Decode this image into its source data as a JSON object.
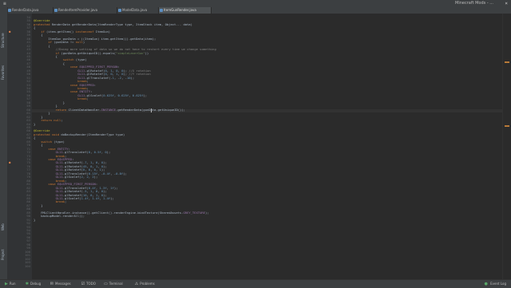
{
  "window": {
    "title": "Minecraft Mods - ..."
  },
  "tabs": [
    {
      "label": "RenderData.java",
      "active": false
    },
    {
      "label": "RenderItemProvider.java",
      "active": false
    },
    {
      "label": "ModelData.java",
      "active": false
    },
    {
      "label": "ItemGunRender.java",
      "active": true
    }
  ],
  "left_tools": [
    "Structure",
    "Favorites",
    "Web",
    "Project"
  ],
  "line_numbers": [
    "34",
    "35",
    "36",
    "37",
    "38",
    "39",
    "40",
    "41",
    "42",
    "43",
    "44",
    "45",
    "46",
    "47",
    "48",
    "49",
    "50",
    "51",
    "52",
    "53",
    "54",
    "55",
    "56",
    "57",
    "58",
    "59",
    "60",
    "61",
    "62",
    "63",
    "64",
    "65",
    "66",
    "67",
    "68",
    "69",
    "70",
    "71",
    "72",
    "73",
    "74",
    "75",
    "76",
    "77",
    "78",
    "79",
    "80",
    "81",
    "82",
    "83",
    "84",
    "85",
    "86",
    "87",
    "88",
    "89",
    "90",
    "91",
    "92",
    "93",
    "94",
    "95",
    "96",
    "97",
    "98",
    "99",
    "100",
    "101",
    "102",
    "103",
    "104"
  ],
  "code_lines": [
    "",
    "@Override",
    "protected RenderData getRenderData(ItemRenderType type, ItemStack item, Object... data)",
    "{",
    "    if (item.getItem() instanceof ItemGun)",
    "    {",
    "        ItemGun gunData = ((ItemGun) item.getItem()).getData(item);",
    "        if (gunData != null)",
    "        {",
    "            //Doing more setting of data so we do not have to restart every time we change something",
    "            if (gunData.getUniqueID().equals(\"simpleLaserGun\"))",
    "            {",
    "                switch (type)",
    "                {",
    "                    case EQUIPPED_FIRST_PERSON:",
    "                        GL11.glRotatef(0, 1, 0, 0); //X rotation",
    "                        GL11.glRotatef(0, 0, 1, 0); //Y rotation",
    "                        GL11.glTranslatef(-1, -2, -10);",
    "                        break;",
    "                    case EQUIPPED:",
    "                        break;",
    "                    case ENTITY:",
    "                        GL11.glScalef(0.625f, 0.625f, 0.625f);",
    "                        break;",
    "                }",
    "            }",
    "            return ClientDataHandler.INSTANCE.getRenderData(gunData.getUniqueID());",
    "        }",
    "    }",
    "    return null;",
    "}",
    "",
    "@Override",
    "protected void doBackupRender(ItemRenderType type)",
    "{",
    "    switch (type)",
    "    {",
    "        case ENTITY:",
    "            GL11.glTranslatef(0, 0.5f, 0);",
    "            break;",
    "        case EQUIPPED:",
    "            GL11.glRotatef(-7, 1, 0, 0);",
    "            GL11.glRotatef(45, 0, 1, 0);",
    "            GL11.glRotatef(0, 0, 0, 1);",
    "            GL11.glTranslatef(0.15f, -0.4f, -0.8f);",
    "            GL11.glScalef(2, 2, 2);",
    "            break;",
    "        case EQUIPPED_FIRST_PERSON:",
    "            GL11.glTranslatef(0.4f, 1.3f, 1f);",
    "            GL11.glRotatef(-5, 1, 0, 0);",
    "            GL11.glRotatef(10, 0, 1, 0);",
    "            GL11.glScalef(1.4f, 1.4f, 1.4f);",
    "            break;",
    "    }",
    "",
    "    FMLClientHandler.instance().getClient().renderEngine.bindTexture(SharedAssets.GREY_TEXTURE);",
    "    backupModel.renderAll();",
    "}"
  ],
  "bottom_tools": [
    {
      "label": "Run",
      "icon": "▶",
      "color": "#59a869"
    },
    {
      "label": "Debug",
      "icon": "✱",
      "color": "#59a869"
    },
    {
      "label": "Messages",
      "icon": "✉",
      "color": "#c4c4c4"
    },
    {
      "label": "TODO",
      "icon": "☑",
      "color": "#c4c4c4"
    },
    {
      "label": "Terminal",
      "icon": "▭",
      "color": "#c4c4c4"
    },
    {
      "label": "Problems",
      "icon": "⚠",
      "color": "#c4c4c4"
    }
  ],
  "event_log": {
    "label": "Event Log",
    "icon": "●"
  },
  "colors": {
    "editor_bg": "#2b2b2b",
    "gutter_bg": "#313335",
    "toolbar_bg": "#3c3f41",
    "keyword": "#cc7832",
    "annotation": "#bbb529",
    "string": "#6a8759",
    "number": "#6897bb",
    "field": "#9876aa",
    "comment": "#808080"
  }
}
